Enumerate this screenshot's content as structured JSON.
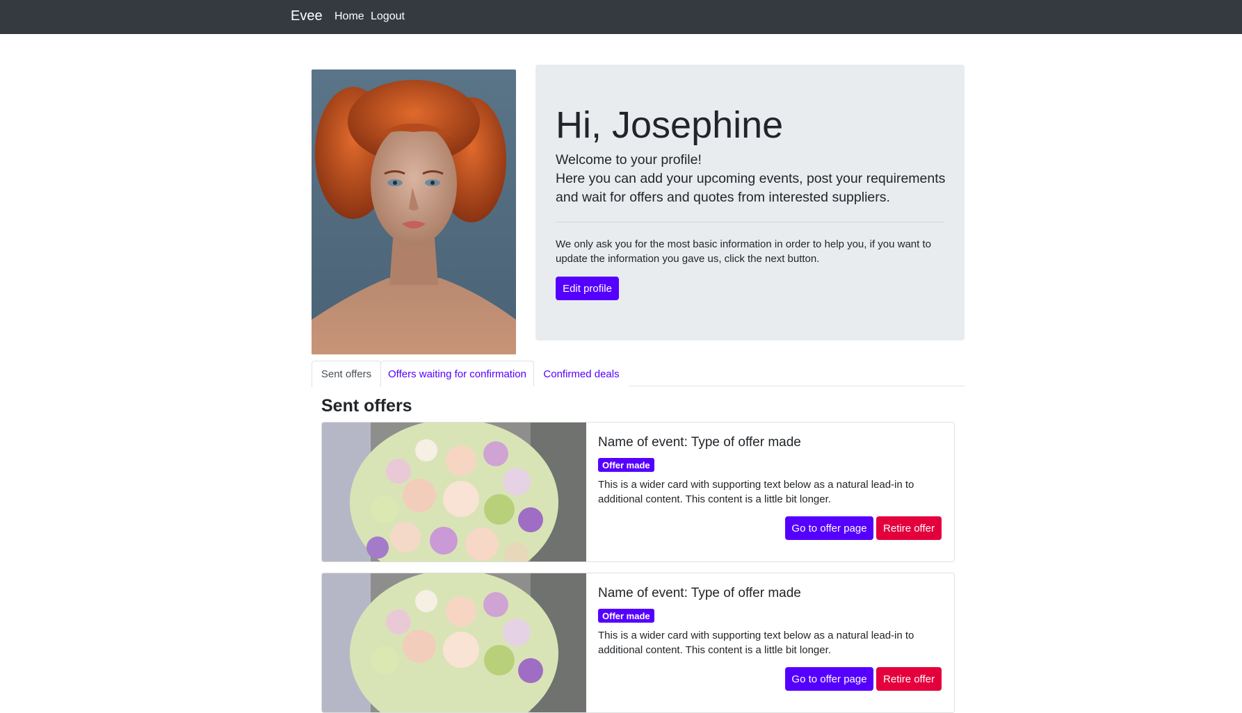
{
  "navbar": {
    "brand": "Evee",
    "links": [
      "Home",
      "Logout"
    ]
  },
  "profile": {
    "greeting": "Hi, Josephine",
    "lead_line1": "Welcome to your profile!",
    "lead_line2": "Here you can add your upcoming events, post your requirements and wait for offers and quotes from interested suppliers.",
    "info": "We only ask you for the most basic information in order to help you, if you want to update the information you gave us, click the next button.",
    "edit_button": "Edit profile"
  },
  "tabs": [
    "Sent offers",
    "Offers waiting for confirmation",
    "Confirmed deals"
  ],
  "section_title": "Sent offers",
  "cards": [
    {
      "title": "Name of event: Type of offer made",
      "badge": "Offer made",
      "text": "This is a wider card with supporting text below as a natural lead-in to additional content. This content is a little bit longer.",
      "primary_button": "Go to offer page",
      "danger_button": "Retire offer"
    },
    {
      "title": "Name of event: Type of offer made",
      "badge": "Offer made",
      "text": "This is a wider card with supporting text below as a natural lead-in to additional content. This content is a little bit longer.",
      "primary_button": "Go to offer page",
      "danger_button": "Retire offer"
    }
  ],
  "colors": {
    "navbar_bg": "#343a40",
    "primary": "#5500ff",
    "danger": "#e4003c",
    "jumbotron_bg": "#e9ecef"
  }
}
